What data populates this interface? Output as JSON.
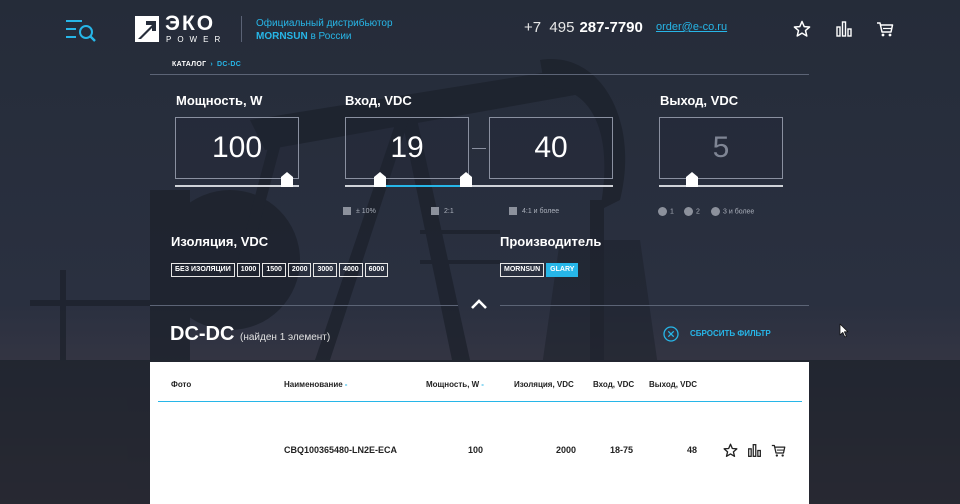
{
  "header": {
    "logo_word": "ЭКО",
    "logo_sub": "POWER",
    "distributor_line1": "Официальный дистрибьютор",
    "distributor_brand": "MORNSUN",
    "distributor_line2_rest": " в России",
    "phone_code": "+7  495",
    "phone_number": "287-7790",
    "email": "order@e-co.ru"
  },
  "breadcrumb": {
    "root": "КАТАЛОГ",
    "separator": "›",
    "current": "DC-DC"
  },
  "filters": {
    "power": {
      "title": "Мощность, W",
      "value": "100",
      "level": 0.9
    },
    "input": {
      "title": "Вход, VDC",
      "min": "19",
      "max": "40",
      "level_min": 0.13,
      "level_max": 0.45
    },
    "output": {
      "title": "Выход, VDC",
      "value": "5",
      "level": 0.27
    },
    "input_options": [
      "± 10%",
      "2:1",
      "4:1 и более"
    ],
    "output_options": [
      "1",
      "2",
      "3 и более"
    ],
    "isolation": {
      "title": "Изоляция, VDC",
      "tags": [
        "БЕЗ ИЗОЛЯЦИИ",
        "1000",
        "1500",
        "2000",
        "3000",
        "4000",
        "6000"
      ]
    },
    "manufacturer": {
      "title": "Производитель",
      "tags": [
        "MORNSUN",
        "GLARY"
      ],
      "active": "GLARY"
    }
  },
  "results": {
    "title": "DC-DC",
    "count_text": "(найден 1 элемент)",
    "reset_label": "СБРОСИТЬ ФИЛЬТР"
  },
  "table": {
    "columns": [
      "Фото",
      "Наименование",
      "Мощность, W",
      "Изоляция, VDC",
      "Вход, VDC",
      "Выход, VDC"
    ],
    "sort_arrows": [
      "",
      "-",
      "-",
      "",
      "",
      ""
    ],
    "rows": [
      {
        "photo": "",
        "name": "CBQ100365480-LN2E-ECA",
        "power": "100",
        "isolation": "2000",
        "input": "18-75",
        "output": "48"
      }
    ]
  },
  "colors": {
    "accent": "#27b6e8",
    "background": "#262d3b",
    "panel": "#ffffff"
  },
  "icons": [
    "menu-search-icon",
    "star-icon",
    "compare-chart-icon",
    "cart-icon",
    "close-circle-icon",
    "chevron-up-icon"
  ]
}
